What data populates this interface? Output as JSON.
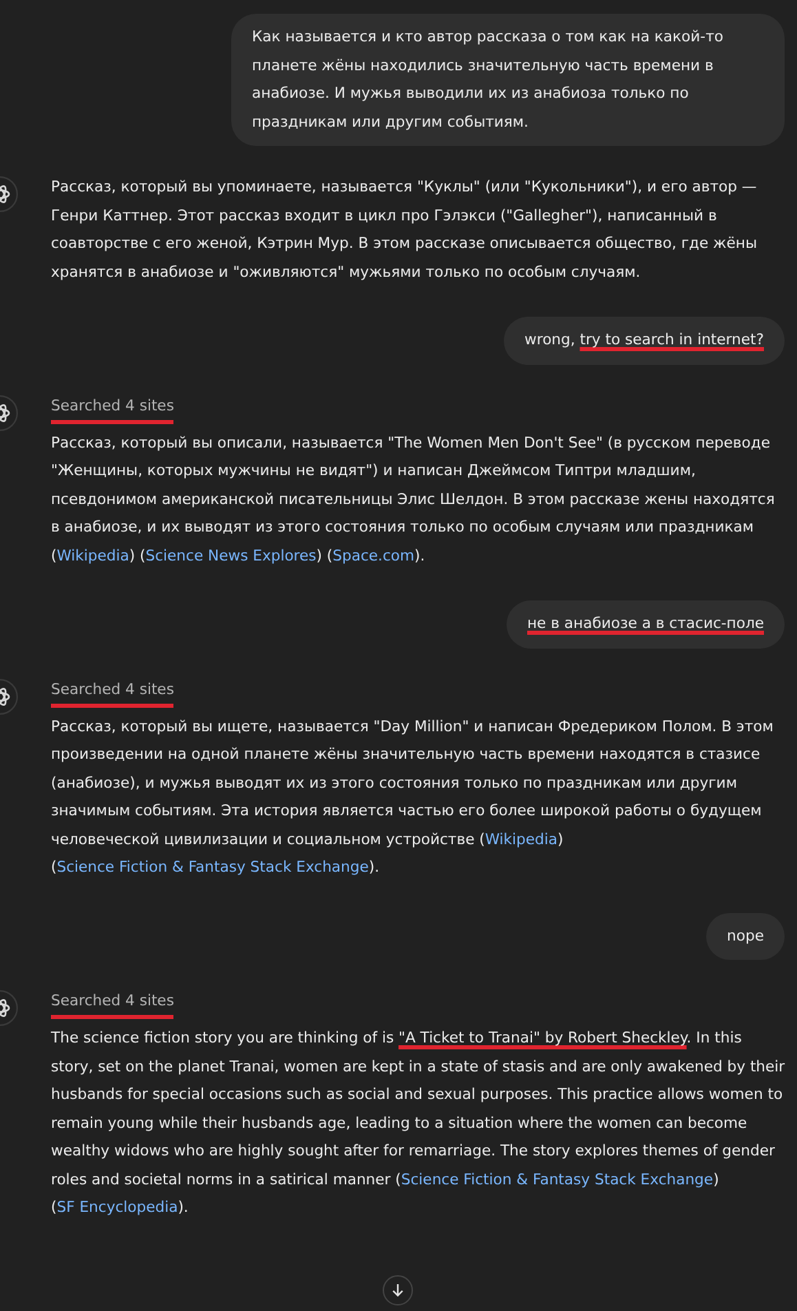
{
  "messages": [
    {
      "kind": "user",
      "segments": [
        {
          "kind": "text",
          "text": "Как называется и кто автор рассказа о том как на какой-то планете жёны находились значительную часть времени в анабиозе. И мужья выводили их из анабиоза только по праздникам или другим событиям.",
          "underlined": false
        }
      ]
    },
    {
      "kind": "assistant",
      "segments": [
        {
          "kind": "text",
          "text": "Рассказ, который вы упоминаете, называется \"Куклы\" (или \"Кукольники\"), и его автор — Генри Каттнер. Этот рассказ входит в цикл про Гэлэкси (\"Gallegher\"), написанный в соавторстве с его женой, Кэтрин Мур. В этом рассказе описывается общество, где жёны хранятся в анабиозе и \"оживляются\" мужьями только по особым случаям.",
          "underlined": false
        }
      ]
    },
    {
      "kind": "user",
      "segments": [
        {
          "kind": "text",
          "text": "wrong, ",
          "underlined": false
        },
        {
          "kind": "text",
          "text": "try to search in internet?",
          "underlined": true
        }
      ]
    },
    {
      "kind": "assistant",
      "searched": {
        "text": "Searched 4 sites",
        "underlined": true
      },
      "segments": [
        {
          "kind": "text",
          "text": "Рассказ, который вы описали, называется \"The Women Men Don't See\" (в русском переводе \"Женщины, которых мужчины не видят\") и написан Джеймсом Типтри младшим, псевдонимом американской писательницы Элис Шелдон. В этом рассказе жены находятся в анабиозе, и их выводят из этого состояния только по особым случаям или праздникам (",
          "underlined": false
        },
        {
          "kind": "link",
          "text": "Wikipedia",
          "underlined": false
        },
        {
          "kind": "text",
          "text": ") (",
          "underlined": false
        },
        {
          "kind": "link",
          "text": "Science News Explores",
          "underlined": false
        },
        {
          "kind": "text",
          "text": ") (",
          "underlined": false
        },
        {
          "kind": "link",
          "text": "Space.com",
          "underlined": false
        },
        {
          "kind": "text",
          "text": ").",
          "underlined": false
        }
      ]
    },
    {
      "kind": "user",
      "segments": [
        {
          "kind": "text",
          "text": "не в анабиозе а в стасис-поле",
          "underlined": true
        }
      ]
    },
    {
      "kind": "assistant",
      "searched": {
        "text": "Searched 4 sites",
        "underlined": true
      },
      "segments": [
        {
          "kind": "text",
          "text": "Рассказ, который вы ищете, называется \"Day Million\" и написан Фредериком Полом. В этом произведении на одной планете жёны значительную часть времени находятся в стазисе (анабиозе), и мужья выводят их из этого состояния только по праздникам или другим значимым событиям. Эта история является частью его более широкой работы о будущем человеческой цивилизации и социальном устройстве (",
          "underlined": false
        },
        {
          "kind": "link",
          "text": "Wikipedia",
          "underlined": false
        },
        {
          "kind": "text",
          "text": ") (",
          "underlined": false
        },
        {
          "kind": "link",
          "text": "Science Fiction & Fantasy Stack Exchange",
          "underlined": false
        },
        {
          "kind": "text",
          "text": ").",
          "underlined": false
        }
      ]
    },
    {
      "kind": "user",
      "segments": [
        {
          "kind": "text",
          "text": "nope",
          "underlined": false
        }
      ]
    },
    {
      "kind": "assistant",
      "searched": {
        "text": "Searched 4 sites",
        "underlined": true
      },
      "segments": [
        {
          "kind": "text",
          "text": "The science fiction story you are thinking of is ",
          "underlined": false
        },
        {
          "kind": "text",
          "text": "\"A Ticket to Tranai\" by Robert Sheckley",
          "underlined": true
        },
        {
          "kind": "text",
          "text": ". In this story, set on the planet Tranai, women are kept in a state of stasis and are only awakened by their husbands for special occasions such as social and sexual purposes. This practice allows women to remain young while their husbands age, leading to a situation where the women can become wealthy widows who are highly sought after for remarriage. The story explores themes of gender roles and societal norms in a satirical manner (",
          "underlined": false
        },
        {
          "kind": "link",
          "text": "Science Fiction & Fantasy Stack Exchange",
          "underlined": false
        },
        {
          "kind": "text",
          "text": ") (",
          "underlined": false
        },
        {
          "kind": "link",
          "text": "SF Encyclopedia",
          "underlined": false
        },
        {
          "kind": "text",
          "text": ").",
          "underlined": false
        }
      ]
    }
  ]
}
